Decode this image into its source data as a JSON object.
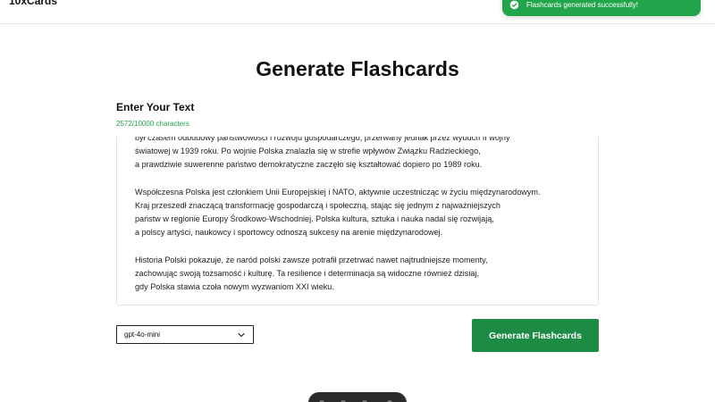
{
  "header": {
    "brand": "10xCards"
  },
  "toast": {
    "message": "Flashcards generated successfully!",
    "color": "#22a54a",
    "icon": "check-circle-icon"
  },
  "main": {
    "title": "Generate Flashcards",
    "input_label": "Enter Your Text",
    "char_count": "2572/10000 characters",
    "text_lines": [
      "był czasem odbudowy państwowości i rozwoju gospodarczego, przerwany jednak przez wybuch II wojny",
      "światowej w 1939 roku. Po wojnie Polska znalazła się w strefie wpływów Związku Radzieckiego,",
      "a prawdziwie suwerenne państwo demokratyczne zaczęło się kształtować dopiero po 1989 roku.",
      "",
      "Współczesna Polska jest członkiem Unii Europejskiej i NATO, aktywnie uczestnicząc w życiu międzynarodowym.",
      "Kraj przeszedł znaczącą transformację gospodarczą i społeczną, stając się jednym z najważniejszych",
      "państw w regionie Europy Środkowo-Wschodniej. Polska kultura, sztuka i nauka nadal się rozwijają,",
      "a polscy artyści, naukowcy i sportowcy odnoszą sukcesy na arenie międzynarodowej.",
      "",
      "Historia Polski pokazuje, że naród polski zawsze potrafił przetrwać nawet najtrudniejsze momenty,",
      "zachowując swoją tożsamość i kulturę. Ta resilience i determinacja są widoczne również dzisiaj,",
      "gdy Polska stawia czoła nowym wyzwaniom XXI wieku."
    ]
  },
  "controls": {
    "model_selected": "gpt-4o-mini",
    "generate_label": "Generate Flashcards",
    "accent_color": "#1c8c45"
  }
}
